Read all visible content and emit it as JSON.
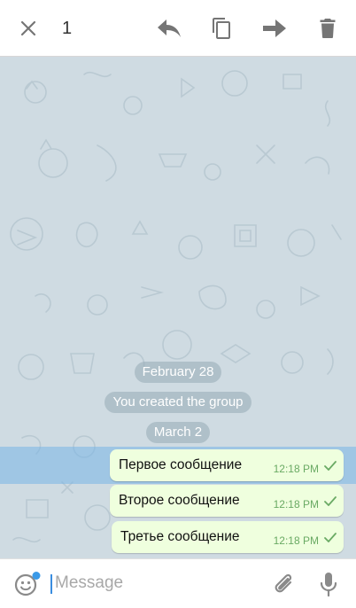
{
  "topbar": {
    "selected_count": "1",
    "actions": [
      {
        "id": "reply",
        "icon": "reply-icon"
      },
      {
        "id": "copy",
        "icon": "copy-icon"
      },
      {
        "id": "forward",
        "icon": "forward-icon"
      },
      {
        "id": "delete",
        "icon": "trash-icon"
      }
    ],
    "close_icon": "close-icon",
    "icon_color": "#757575"
  },
  "chat": {
    "background_color": "#cfdbe2",
    "service_messages": [
      "February 28",
      "You created the group",
      "March 2"
    ],
    "selected_highlight": "#9ecbef",
    "messages": [
      {
        "text": "Первое сообщение",
        "time": "12:18 PM",
        "status": "check-icon",
        "selected": true
      },
      {
        "text": "Второе сообщение",
        "time": "12:18 PM",
        "status": "check-icon",
        "selected": false
      },
      {
        "text": "Третье сообщение",
        "time": "12:18 PM",
        "status": "check-icon",
        "selected": false
      }
    ],
    "bubble_color": "#efffde",
    "time_color": "#6aaa64"
  },
  "input": {
    "placeholder": "Message",
    "value": "",
    "left_icon": "emoji-icon",
    "right_icons": [
      "attach-icon",
      "microphone-icon"
    ],
    "emoji_badge_color": "#3a9ae8"
  }
}
